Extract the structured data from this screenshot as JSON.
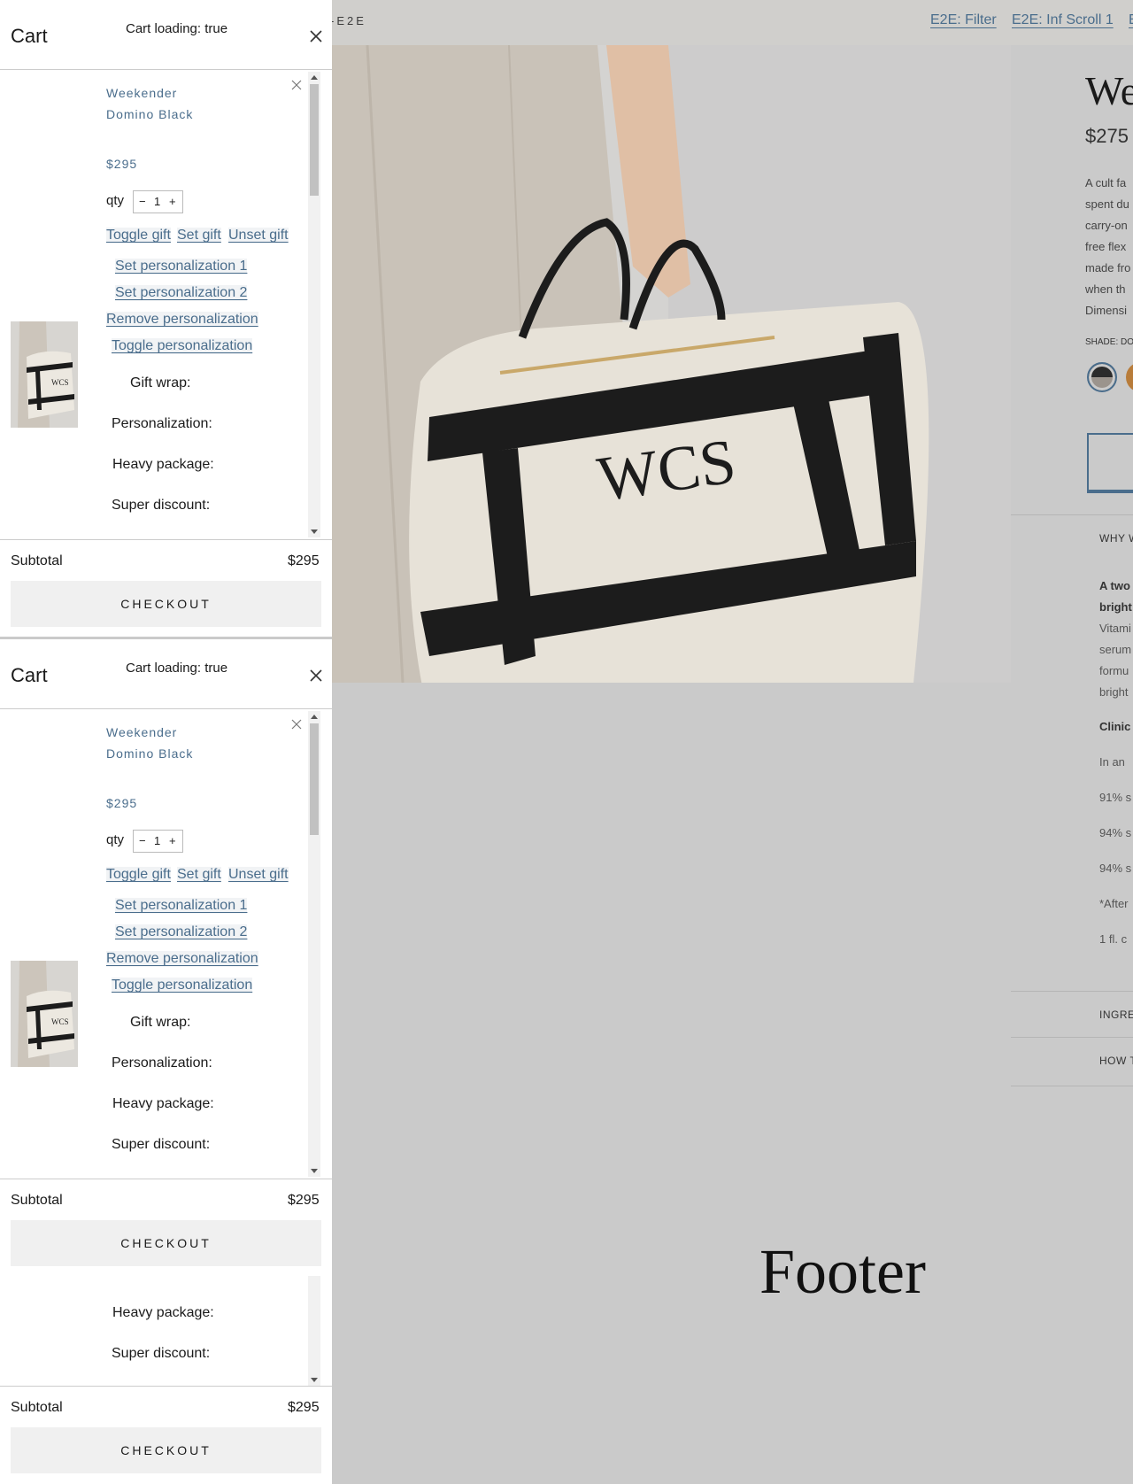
{
  "nav": {
    "brand": "-E2E",
    "links": [
      "E2E: Filter",
      "E2E: Inf Scroll 1",
      "E"
    ]
  },
  "product": {
    "title": "We",
    "price": "$275",
    "description_lines": [
      "A cult fa",
      "spent du",
      "carry-on",
      "free flex",
      "made fro",
      "when th",
      "Dimensi"
    ],
    "shade_label": "SHADE: DO",
    "accordions": [
      "WHY W",
      "INGRE",
      "HOW T"
    ],
    "body": {
      "lead1": "A two",
      "lead2": "bright",
      "lines": [
        "Vitami",
        "serum",
        "formu",
        "bright"
      ],
      "clinical": "Clinic",
      "in_an": "In an",
      "stats": [
        "91% s",
        "94% s",
        "94% s"
      ],
      "after": "*After",
      "size": "1 fl. c"
    },
    "hero_monogram": "WCS"
  },
  "footer": {
    "title": "Footer"
  },
  "cart": {
    "title": "Cart",
    "loading": "Cart loading: true",
    "item": {
      "name_line1": "Weekender",
      "name_line2": "Domino Black",
      "price": "$295",
      "qty_label": "qty",
      "qty_minus": "−",
      "qty_value": "1",
      "qty_plus": "+",
      "thumb_monogram": "WCS"
    },
    "actions": {
      "toggle_gift": "Toggle gift",
      "set_gift": "Set gift",
      "unset_gift": "Unset gift",
      "set_personalization_1": "Set personalization 1",
      "set_personalization_2": "Set personalization 2",
      "remove_personalization": "Remove personalization",
      "toggle_personalization": "Toggle personalization"
    },
    "meta": {
      "gift_wrap": "Gift wrap:",
      "personalization": "Personalization:",
      "heavy_package": "Heavy package:",
      "super_discount": "Super discount:"
    },
    "subtotal_label": "Subtotal",
    "subtotal_value": "$295",
    "checkout_label": "CHECKOUT"
  }
}
